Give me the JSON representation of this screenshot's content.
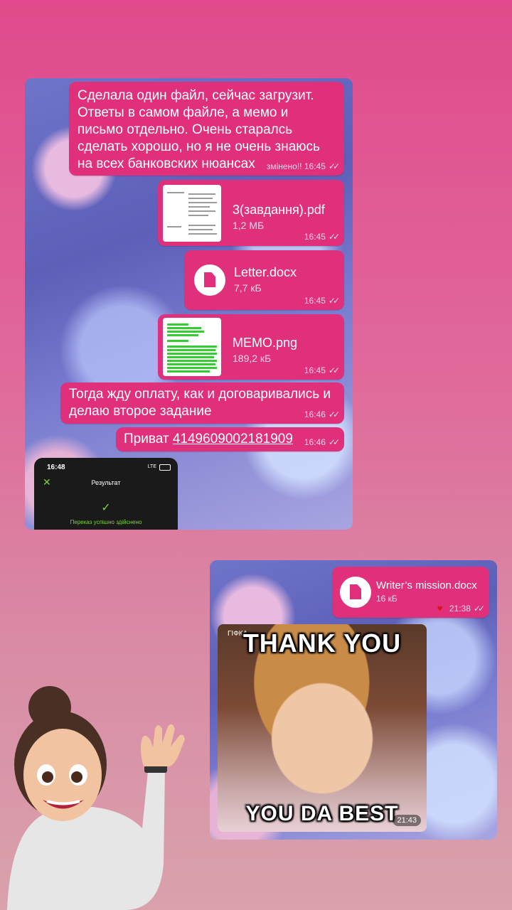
{
  "chat1": {
    "msg1": {
      "text": "Сделала один файл, сейчас загрузит. Ответы в самом файле, а мемо и письмо отдельно. Очень старалсь сделать хорошо, но я не очень знаюсь на всех банковских нюансах",
      "edited": "змінено!!",
      "time": "16:45"
    },
    "file1": {
      "name": "3(завдання).pdf",
      "size": "1,2 МБ",
      "time": "16:45"
    },
    "file2": {
      "name": "Letter.docx",
      "size": "7,7 кБ",
      "time": "16:45"
    },
    "file3": {
      "name": "MEMO.png",
      "size": "189,2 кБ",
      "time": "16:45"
    },
    "msg2": {
      "text": "Тогда жду оплату, как и договаривались и делаю второе задание",
      "time": "16:46"
    },
    "msg3": {
      "prefix": "Приват",
      "number": "4149609002181909",
      "time": "16:46"
    },
    "phone": {
      "clock": "16:48",
      "signal": "LTE",
      "title": "Результат",
      "status": "Переказ успішно здійснено"
    }
  },
  "chat2": {
    "file": {
      "name": "Writer’s mission.docx",
      "size": "16 кБ",
      "time": "21:38"
    },
    "gif": {
      "badge": "ГІФКА",
      "top_text": "THANK YOU",
      "bottom_text": "YOU DA BEST",
      "time": "21:43"
    }
  },
  "colors": {
    "bubble": "#e0307b",
    "success": "#7fd13b"
  }
}
